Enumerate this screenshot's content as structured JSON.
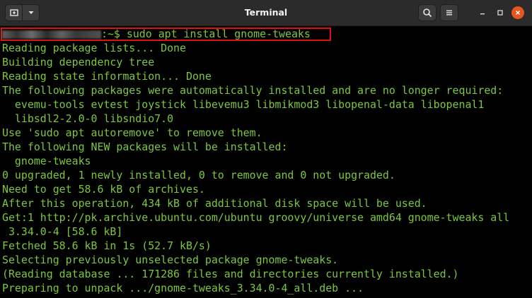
{
  "window": {
    "title": "Terminal"
  },
  "colors": {
    "terminal_text": "#7dc73b",
    "background": "#000000",
    "titlebar": "#2b2b2b",
    "highlight": "#e01010",
    "close_button": "#e95420"
  },
  "icons": {
    "new_tab": "new-tab-icon",
    "dropdown": "chevron-down-icon",
    "search": "search-icon",
    "menu": "hamburger-menu-icon",
    "minimize": "minimize-icon",
    "maximize": "maximize-icon",
    "close": "close-icon"
  },
  "terminal": {
    "prompt_suffix": ":~$ ",
    "command": "sudo apt install gnome-tweaks",
    "output": [
      "Reading package lists... Done",
      "Building dependency tree",
      "Reading state information... Done",
      "The following packages were automatically installed and are no longer required:",
      "  evemu-tools evtest joystick libevemu3 libmikmod3 libopenal-data libopenal1",
      "  libsdl2-2.0-0 libsndio7.0",
      "Use 'sudo apt autoremove' to remove them.",
      "The following NEW packages will be installed:",
      "  gnome-tweaks",
      "0 upgraded, 1 newly installed, 0 to remove and 0 not upgraded.",
      "Need to get 58.6 kB of archives.",
      "After this operation, 434 kB of additional disk space will be used.",
      "Get:1 http://pk.archive.ubuntu.com/ubuntu groovy/universe amd64 gnome-tweaks all",
      " 3.34.0-4 [58.6 kB]",
      "Fetched 58.6 kB in 1s (52.7 kB/s)",
      "Selecting previously unselected package gnome-tweaks.",
      "(Reading database ... 171286 files and directories currently installed.)",
      "Preparing to unpack .../gnome-tweaks_3.34.0-4_all.deb ..."
    ]
  }
}
